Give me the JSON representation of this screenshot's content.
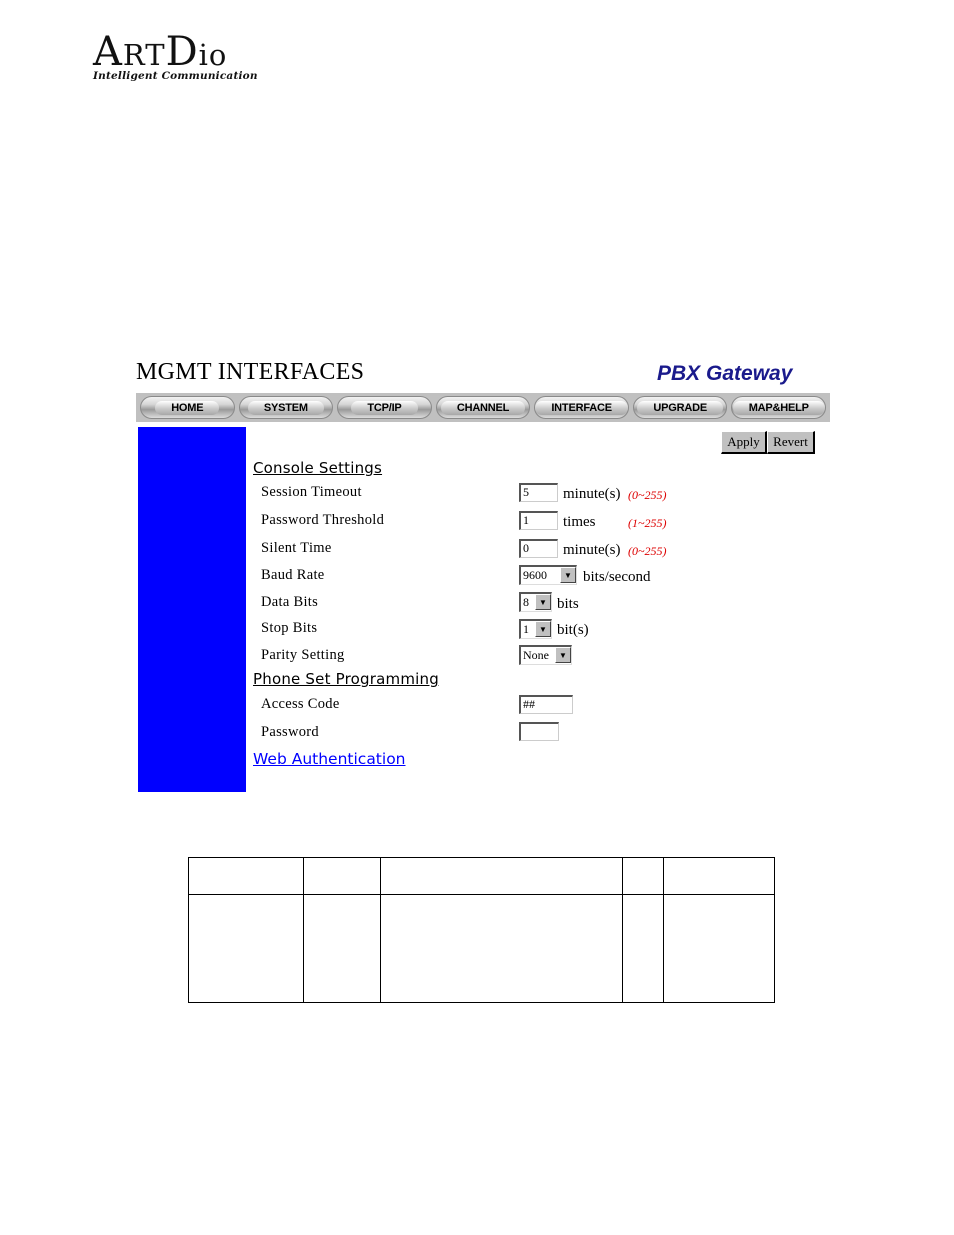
{
  "logo": {
    "brand_big_a": "A",
    "brand_small_rt": "RT",
    "brand_big_d": "D",
    "brand_small_io": "io",
    "tagline": "Intelligent Communication"
  },
  "header": {
    "page_title": "MGMT INTERFACES",
    "product_title": "PBX Gateway"
  },
  "nav": {
    "items": [
      {
        "label": "HOME"
      },
      {
        "label": "SYSTEM"
      },
      {
        "label": "TCP/IP"
      },
      {
        "label": "CHANNEL"
      },
      {
        "label": "INTERFACE"
      },
      {
        "label": "UPGRADE"
      },
      {
        "label": "MAP&HELP"
      }
    ]
  },
  "colors": {
    "side_panel": "#0000ff",
    "range_hint": "#dd0000",
    "link": "#0000ff",
    "product_title": "#1a1a8c"
  },
  "actions": {
    "apply_label": "Apply",
    "revert_label": "Revert"
  },
  "console": {
    "heading": "Console Settings",
    "session_timeout": {
      "label": "Session Timeout",
      "value": "5",
      "unit": "minute(s)",
      "range": "(0~255)"
    },
    "password_threshold": {
      "label": "Password Threshold",
      "value": "1",
      "unit": "times",
      "range": "(1~255)"
    },
    "silent_time": {
      "label": "Silent Time",
      "value": "0",
      "unit": "minute(s)",
      "range": "(0~255)"
    },
    "baud_rate": {
      "label": "Baud Rate",
      "selected": "9600",
      "unit": "bits/second"
    },
    "data_bits": {
      "label": "Data Bits",
      "selected": "8",
      "unit": "bits"
    },
    "stop_bits": {
      "label": "Stop Bits",
      "selected": "1",
      "unit": "bit(s)"
    },
    "parity": {
      "label": "Parity Setting",
      "selected": "None"
    }
  },
  "phone_set": {
    "heading": "Phone Set Programming",
    "access_code": {
      "label": "Access Code",
      "value": "##"
    },
    "password": {
      "label": "Password",
      "value": ""
    }
  },
  "web_auth": {
    "link_label": "Web Authentication"
  },
  "doc_table": {
    "rows": [
      [
        "",
        "",
        "",
        "",
        ""
      ],
      [
        "",
        "",
        "",
        "",
        ""
      ]
    ]
  }
}
